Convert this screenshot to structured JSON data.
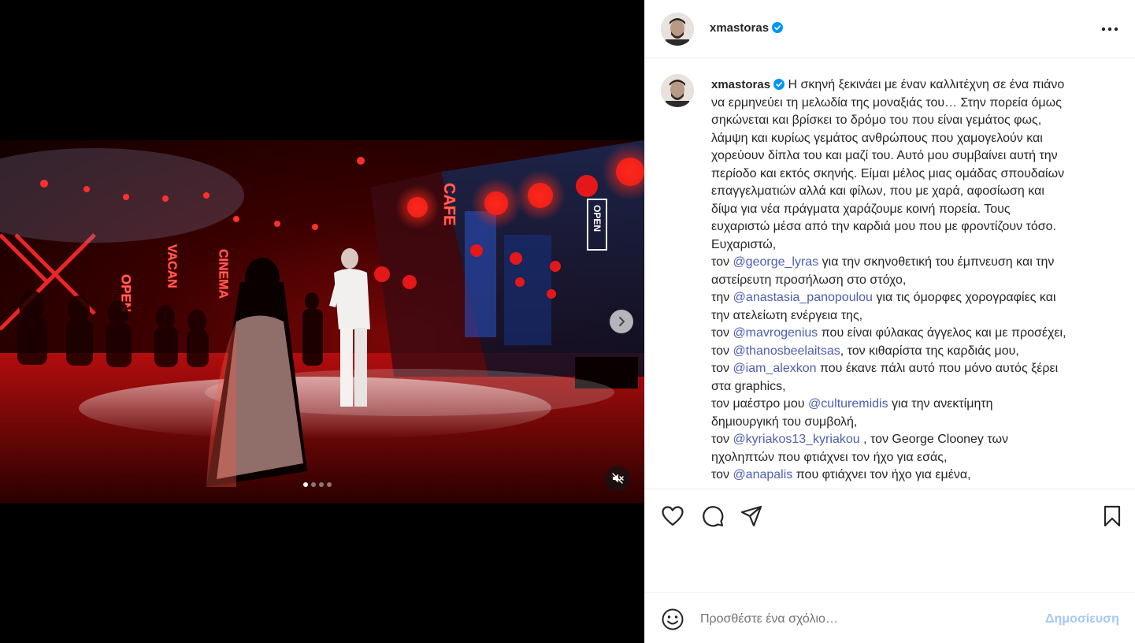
{
  "colors": {
    "accent": "#0095f6",
    "mention": "#4d5eb3",
    "post_disabled": "#a6c8f5",
    "border": "#efefef"
  },
  "media": {
    "slide_count": 4,
    "active_slide": 1,
    "muted": true,
    "neon_signs": [
      "OPEN",
      "VACAN",
      "CINEMA",
      "CAFE",
      "OPEN"
    ]
  },
  "header": {
    "username": "xmastoras",
    "verified": true,
    "more_icon": "more-options-icon"
  },
  "caption": {
    "username": "xmastoras",
    "lines": [
      [
        {
          "t": "Η σκηνή ξεκινάει με έναν καλλιτέχνη σε ένα πιάνο",
          "m": false
        }
      ],
      [
        {
          "t": "να ερμηνεύει τη μελωδία της μοναξιάς του… Στην πορεία όμως",
          "m": false
        }
      ],
      [
        {
          "t": "σηκώνεται και βρίσκει το δρόμο του που είναι γεμάτος φως,",
          "m": false
        }
      ],
      [
        {
          "t": "λάμψη και κυρίως γεμάτος ανθρώπους που χαμογελούν και",
          "m": false
        }
      ],
      [
        {
          "t": "χορεύουν δίπλα του και μαζί του. Αυτό μου συμβαίνει αυτή την",
          "m": false
        }
      ],
      [
        {
          "t": "περίοδο και εκτός σκηνής. Είμαι μέλος μιας ομάδας σπουδαίων",
          "m": false
        }
      ],
      [
        {
          "t": "επαγγελματιών αλλά και φίλων, που με χαρά, αφοσίωση και",
          "m": false
        }
      ],
      [
        {
          "t": "δίψα για νέα πράγματα χαράζουμε κοινή πορεία. Τους",
          "m": false
        }
      ],
      [
        {
          "t": "ευχαριστώ μέσα από την καρδιά μου που με φροντίζουν τόσο.",
          "m": false
        }
      ],
      [
        {
          "t": "Ευχαριστώ,",
          "m": false
        }
      ],
      [
        {
          "t": "τον ",
          "m": false
        },
        {
          "t": "@george_lyras",
          "m": true
        },
        {
          "t": " για την σκηνοθετική του έμπνευση και την",
          "m": false
        }
      ],
      [
        {
          "t": "αστείρευτη προσήλωση στο στόχο,",
          "m": false
        }
      ],
      [
        {
          "t": "την ",
          "m": false
        },
        {
          "t": "@anastasia_panopoulou",
          "m": true
        },
        {
          "t": " για τις όμορφες χορογραφίες και",
          "m": false
        }
      ],
      [
        {
          "t": "την ατελείωτη ενέργεια της,",
          "m": false
        }
      ],
      [
        {
          "t": "τον ",
          "m": false
        },
        {
          "t": "@mavrogenius",
          "m": true
        },
        {
          "t": " που είναι φύλακας άγγελος και με προσέχει,",
          "m": false
        }
      ],
      [
        {
          "t": "τον ",
          "m": false
        },
        {
          "t": "@thanosbeelaitsas",
          "m": true
        },
        {
          "t": ", τον κιθαρίστα της καρδιάς μου,",
          "m": false
        }
      ],
      [
        {
          "t": "τον ",
          "m": false
        },
        {
          "t": "@iam_alexkon",
          "m": true
        },
        {
          "t": " που έκανε πάλι αυτό που μόνο αυτός ξέρει",
          "m": false
        }
      ],
      [
        {
          "t": "στα graphics,",
          "m": false
        }
      ],
      [
        {
          "t": "τον μαέστρο μου ",
          "m": false
        },
        {
          "t": "@culturemidis",
          "m": true
        },
        {
          "t": " για την ανεκτίμητη",
          "m": false
        }
      ],
      [
        {
          "t": "δημιουργική του συμβολή,",
          "m": false
        }
      ],
      [
        {
          "t": "τον ",
          "m": false
        },
        {
          "t": "@kyriakos13_kyriakou",
          "m": true
        },
        {
          "t": " , τον George Clooney των",
          "m": false
        }
      ],
      [
        {
          "t": "ηχοληπτών που φτιάχνει τον ήχο για εσάς,",
          "m": false
        }
      ],
      [
        {
          "t": "τον ",
          "m": false
        },
        {
          "t": "@anapalis",
          "m": true
        },
        {
          "t": " που φτιάχνει τον ήχο για εμένα,",
          "m": false
        }
      ]
    ]
  },
  "actions": {
    "like_icon": "heart-icon",
    "comment_icon": "comment-icon",
    "share_icon": "share-icon",
    "save_icon": "bookmark-icon"
  },
  "comment": {
    "placeholder": "Προσθέστε ένα σχόλιο…",
    "post_label": "Δημοσίευση",
    "emoji_icon": "emoji-icon"
  }
}
